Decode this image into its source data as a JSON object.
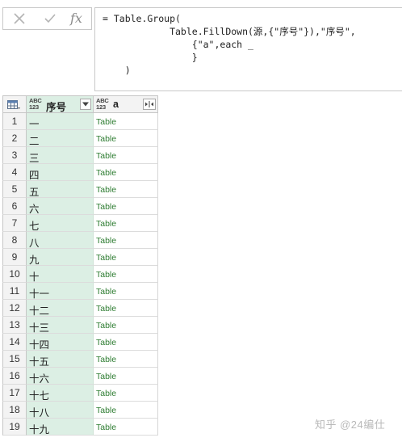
{
  "formula_bar": {
    "cancel_icon": "close-icon",
    "commit_icon": "check-icon",
    "fx_label": "fx",
    "formula_text": "= Table.Group(\n            Table.FillDown(源,{\"序号\"}),\"序号\",\n                {\"a\",each _\n                }\n    )"
  },
  "grid": {
    "corner_icon": "table-icon",
    "columns": [
      {
        "type_tag": "ABC\n123",
        "title": "序号",
        "button_icon": "filter-dropdown-icon"
      },
      {
        "type_tag": "ABC\n123",
        "title": "a",
        "button_icon": "expand-columns-icon"
      }
    ],
    "rows": [
      {
        "num": "1",
        "key": "一",
        "value": "Table"
      },
      {
        "num": "2",
        "key": "二",
        "value": "Table"
      },
      {
        "num": "3",
        "key": "三",
        "value": "Table"
      },
      {
        "num": "4",
        "key": "四",
        "value": "Table"
      },
      {
        "num": "5",
        "key": "五",
        "value": "Table"
      },
      {
        "num": "6",
        "key": "六",
        "value": "Table"
      },
      {
        "num": "7",
        "key": "七",
        "value": "Table"
      },
      {
        "num": "8",
        "key": "八",
        "value": "Table"
      },
      {
        "num": "9",
        "key": "九",
        "value": "Table"
      },
      {
        "num": "10",
        "key": "十",
        "value": "Table"
      },
      {
        "num": "11",
        "key": "十一",
        "value": "Table"
      },
      {
        "num": "12",
        "key": "十二",
        "value": "Table"
      },
      {
        "num": "13",
        "key": "十三",
        "value": "Table"
      },
      {
        "num": "14",
        "key": "十四",
        "value": "Table"
      },
      {
        "num": "15",
        "key": "十五",
        "value": "Table"
      },
      {
        "num": "16",
        "key": "十六",
        "value": "Table"
      },
      {
        "num": "17",
        "key": "十七",
        "value": "Table"
      },
      {
        "num": "18",
        "key": "十八",
        "value": "Table"
      },
      {
        "num": "19",
        "key": "十九",
        "value": "Table"
      }
    ]
  },
  "colors": {
    "key_column_bg": "#dcefe4",
    "table_link": "#2e7d32"
  },
  "watermark": "知乎 @24编仕"
}
